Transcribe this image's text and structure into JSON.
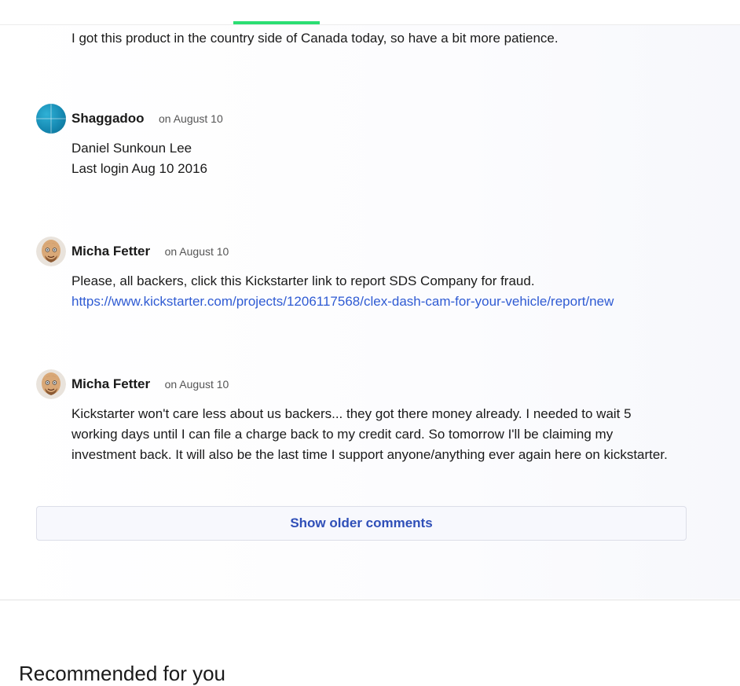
{
  "comments": {
    "partial_body": "I got this product in the country side of Canada today, so have a bit more patience.",
    "items": [
      {
        "author": "Shaggadoo",
        "date": "on August 10",
        "lines": [
          "Daniel Sunkoun Lee",
          "Last login Aug 10 2016"
        ],
        "avatar": "teal-circle-avatar"
      },
      {
        "author": "Micha Fetter",
        "date": "on August 10",
        "text": "Please, all backers, click this Kickstarter link to report SDS Company for fraud.",
        "link": "https://www.kickstarter.com/projects/1206117568/clex-dash-cam-for-your-vehicle/report/new",
        "avatar": "cartoon-face-avatar"
      },
      {
        "author": "Micha Fetter",
        "date": "on August 10",
        "lines": [
          "Kickstarter won't care less about us backers... they got there money already. I needed to wait 5",
          "working days until I can file a charge back to my credit card. So tomorrow I'll be claiming my",
          "investment back. It will also be the last time I support anyone/anything ever again here on kickstarter."
        ],
        "avatar": "cartoon-face-avatar"
      }
    ],
    "show_older_label": "Show older comments"
  },
  "recommended": {
    "heading": "Recommended for you"
  },
  "colors": {
    "tab_indicator": "#2bde73",
    "link": "#2f5bd3",
    "button_text": "#2f4fb8"
  }
}
